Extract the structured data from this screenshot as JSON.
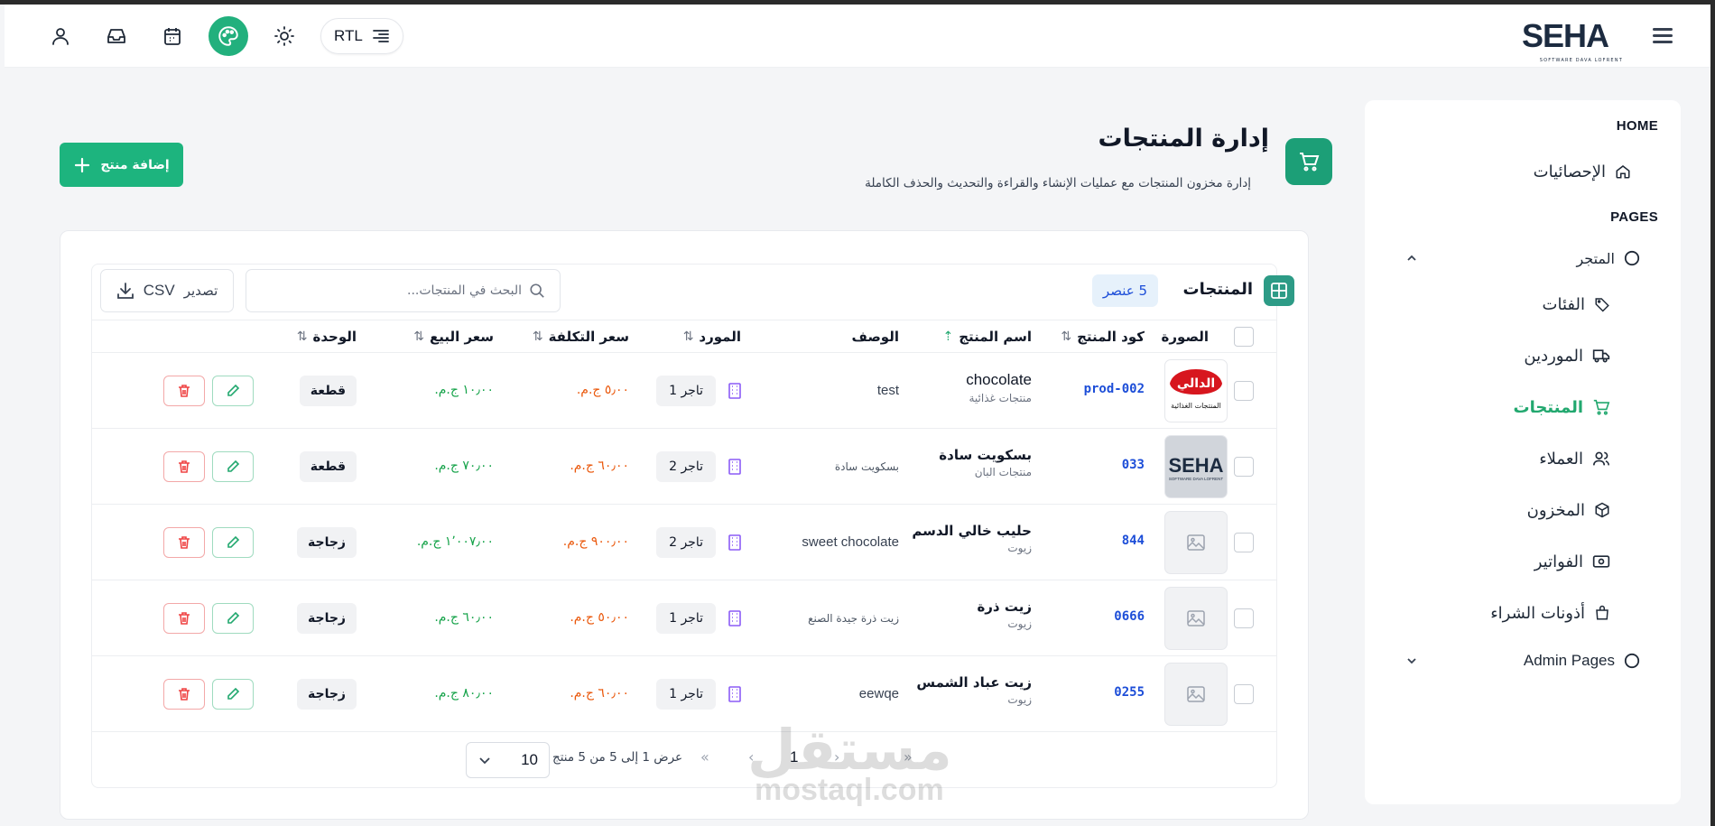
{
  "header": {
    "logo_text": "SEHA",
    "logo_sub": "SOFTWARE DAVA LOFRENT",
    "rtl_label": "RTL",
    "icons": [
      "user-icon",
      "inbox-icon",
      "calendar-icon",
      "palette-icon",
      "sun-icon",
      "align-right-icon",
      "menu-icon"
    ]
  },
  "sidebar": {
    "section_home": "HOME",
    "section_pages": "PAGES",
    "items": [
      {
        "label": "الإحصائيات",
        "icon": "home-icon"
      },
      {
        "label": "المتجر",
        "icon": "circle-icon"
      },
      {
        "label": "الفئات",
        "icon": "tag-icon"
      },
      {
        "label": "الموردين",
        "icon": "truck-icon"
      },
      {
        "label": "المنتجات",
        "icon": "cart-icon"
      },
      {
        "label": "العملاء",
        "icon": "users-icon"
      },
      {
        "label": "المخزون",
        "icon": "box-icon"
      },
      {
        "label": "الفواتير",
        "icon": "banknote-icon"
      },
      {
        "label": "أذونات الشراء",
        "icon": "bag-icon"
      },
      {
        "label": "Admin Pages",
        "icon": "circle-icon"
      }
    ]
  },
  "page": {
    "title": "إدارة المنتجات",
    "subtitle": "إدارة مخزون المنتجات مع عمليات الإنشاء والقراءة والتحديث والحذف الكاملة",
    "add_button": "إضافة منتج"
  },
  "table": {
    "title": "المنتجات",
    "count_badge": "5 عنصر",
    "search_placeholder": "البحث في المنتجات...",
    "export_label": "تصدير",
    "export_format": "CSV",
    "columns": {
      "image": "الصورة",
      "code": "كود المنتج",
      "name": "اسم المنتج",
      "description": "الوصف",
      "supplier": "المورد",
      "cost": "سعر التكلفة",
      "sale": "سعر البيع",
      "unit": "الوحدة"
    },
    "rows": [
      {
        "image": "brand-logo-daly",
        "code": "prod-002",
        "name": "chocolate",
        "category": "منتجات غذائية",
        "description": "test",
        "supplier": "تاجر 1",
        "cost": "٥٫٠٠ ج.م.",
        "sale": "١٠٫٠٠ ج.م.",
        "unit": "قطعة"
      },
      {
        "image": "brand-logo-seha",
        "code": "033",
        "name": "بسكويت سادة",
        "category": "منتجات البان",
        "description": "بسكويت سادة",
        "supplier": "تاجر 2",
        "cost": "٦٠٫٠٠ ج.م.",
        "sale": "٧٠٫٠٠ ج.م.",
        "unit": "قطعة"
      },
      {
        "image": "placeholder-image-icon",
        "code": "844",
        "name": "حليب خالي الدسم",
        "category": "زيوت",
        "description": "sweet chocolate",
        "supplier": "تاجر 2",
        "cost": "٩٠٠٫٠٠ ج.م.",
        "sale": "١٬٠٠٧٫٠٠ ج.م.",
        "unit": "زجاجة"
      },
      {
        "image": "placeholder-image-icon",
        "code": "0666",
        "name": "زيت ذرة",
        "category": "زيوت",
        "description": "زيت ذرة جيدة الصنع",
        "supplier": "تاجر 1",
        "cost": "٥٠٫٠٠ ج.م.",
        "sale": "٦٠٫٠٠ ج.م.",
        "unit": "زجاجة"
      },
      {
        "image": "placeholder-image-icon",
        "code": "0255",
        "name": "زيت عباد الشمس",
        "category": "زيوت",
        "description": "eewqe",
        "supplier": "تاجر 1",
        "cost": "٦٠٫٠٠ ج.م.",
        "sale": "٨٠٫٠٠ ج.م.",
        "unit": "زجاجة"
      }
    ]
  },
  "pagination": {
    "info": "عرض 1 إلى 5 من 5 منتج",
    "current_page": "1",
    "page_size": "10"
  },
  "watermark": {
    "arabic": "مستقل",
    "latin": "mostaql.com"
  },
  "colors": {
    "accent": "#1db47e",
    "link": "#1d4ed8",
    "cost": "#ea580c",
    "sale": "#16a34a"
  }
}
